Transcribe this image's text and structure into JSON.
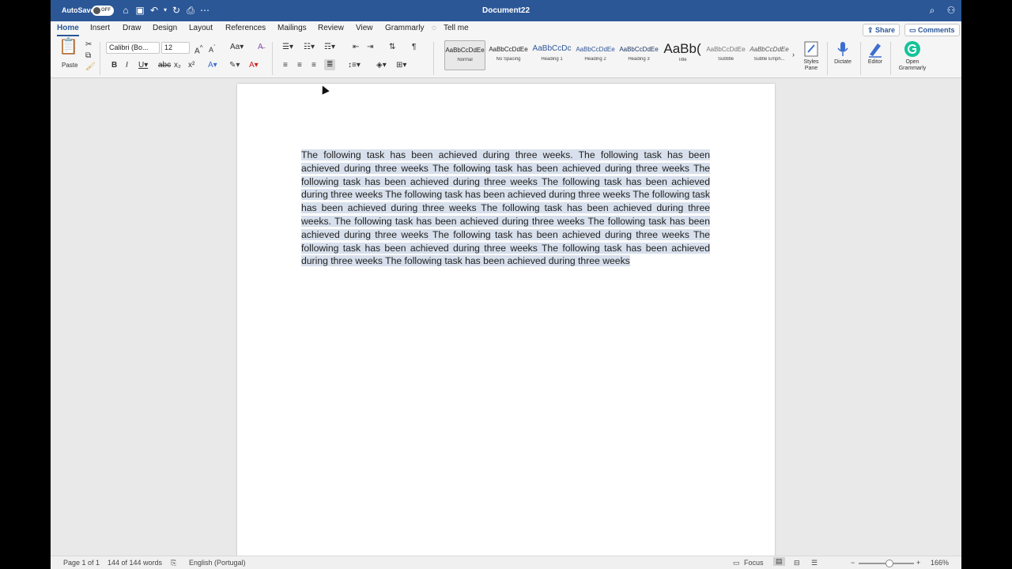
{
  "titlebar": {
    "autosave_label": "AutoSave",
    "autosave_state": "OFF",
    "document_title": "Document22"
  },
  "ribbon": {
    "tabs": [
      {
        "label": "Home",
        "active": true
      },
      {
        "label": "Insert"
      },
      {
        "label": "Draw"
      },
      {
        "label": "Design"
      },
      {
        "label": "Layout"
      },
      {
        "label": "References"
      },
      {
        "label": "Mailings"
      },
      {
        "label": "Review"
      },
      {
        "label": "View"
      },
      {
        "label": "Grammarly"
      },
      {
        "label": "Tell me"
      }
    ],
    "share_label": "Share",
    "comments_label": "Comments",
    "paste_label": "Paste",
    "font_name": "Calibri (Bo...",
    "font_size": "12",
    "styles": [
      {
        "sample": "AaBbCcDdEe",
        "name": "Normal",
        "active": true
      },
      {
        "sample": "AaBbCcDdEe",
        "name": "No Spacing"
      },
      {
        "sample": "AaBbCcDc",
        "name": "Heading 1"
      },
      {
        "sample": "AaBbCcDdEe",
        "name": "Heading 2"
      },
      {
        "sample": "AaBbCcDdEe",
        "name": "Heading 3"
      },
      {
        "sample": "AaBb(",
        "name": "Title"
      },
      {
        "sample": "AaBbCcDdEe",
        "name": "Subtitle"
      },
      {
        "sample": "AaBbCcDdEe",
        "name": "Subtle Emph..."
      }
    ],
    "styles_pane_label": "Styles Pane",
    "dictate_label": "Dictate",
    "editor_label": "Editor",
    "open_grammarly_label": "Open Grammarly"
  },
  "document": {
    "paragraph": "The following task has been achieved during three weeks. The following task has been achieved during three weeks The following task has been achieved during three weeks The following task has been achieved during three weeks The following task has been achieved during three weeks The following task has been achieved during three weeks The following task has been achieved during three weeks The following task has been achieved during three weeks. The following task has been achieved during three weeks The following task has been achieved during three weeks The following task has been achieved during three weeks The following task has been achieved during three weeks The following task has been achieved during three weeks The following task has been achieved during three weeks"
  },
  "statusbar": {
    "page": "Page 1 of 1",
    "words": "144 of 144 words",
    "language": "English (Portugal)",
    "focus_label": "Focus",
    "zoom": "166%"
  },
  "colors": {
    "titlebar": "#2b5797",
    "selection": "#d7e0ec",
    "grammarly": "#15c39a"
  }
}
